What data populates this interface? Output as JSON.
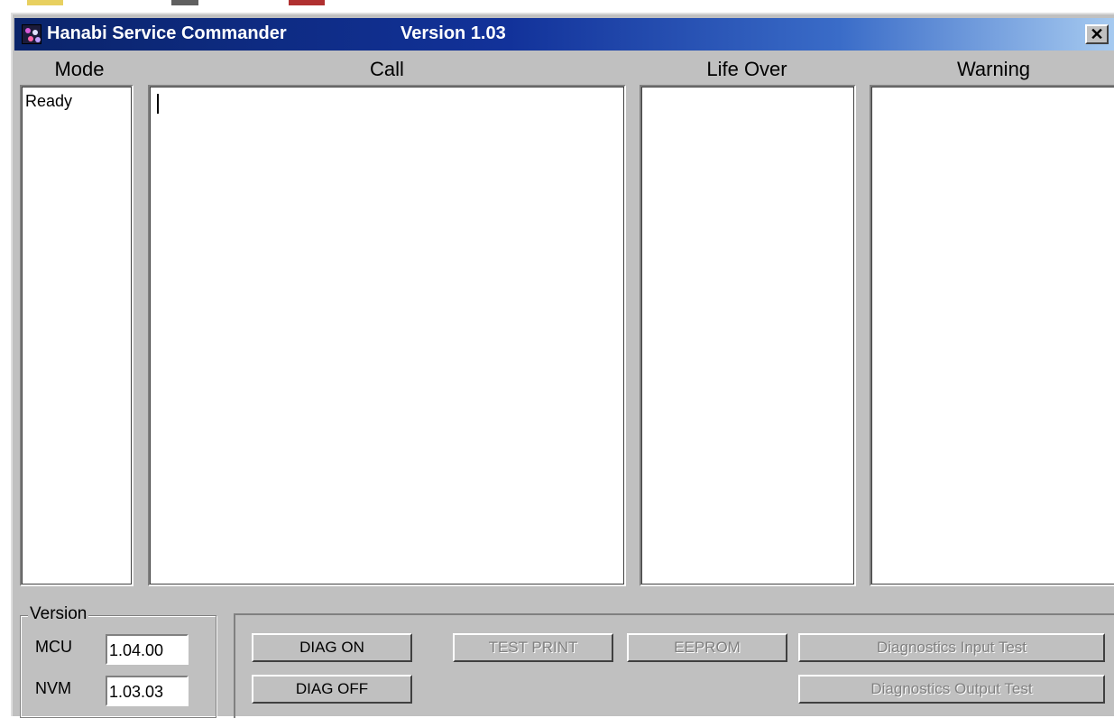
{
  "window": {
    "title": "Hanabi Service Commander",
    "version_label": "Version 1.03",
    "close_glyph": "✕"
  },
  "columns": {
    "mode": {
      "label": "Mode",
      "content": "Ready"
    },
    "call": {
      "label": "Call",
      "content": ""
    },
    "life_over": {
      "label": "Life Over",
      "content": ""
    },
    "warning": {
      "label": "Warning",
      "content": ""
    }
  },
  "version_group": {
    "legend": "Version",
    "mcu": {
      "label": "MCU",
      "value": "1.04.00"
    },
    "nvm": {
      "label": "NVM",
      "value": "1.03.03"
    }
  },
  "buttons": {
    "diag_on": "DIAG ON",
    "diag_off": "DIAG OFF",
    "test_print": "TEST PRINT",
    "eeprom": "EEPROM",
    "diag_input": "Diagnostics Input Test",
    "diag_output": "Diagnostics Output Test"
  },
  "colors": {
    "title_bar_start": "#0a246a",
    "title_bar_end": "#a6caf0",
    "window_face": "#c0c0c0",
    "disabled_text": "#808080"
  }
}
